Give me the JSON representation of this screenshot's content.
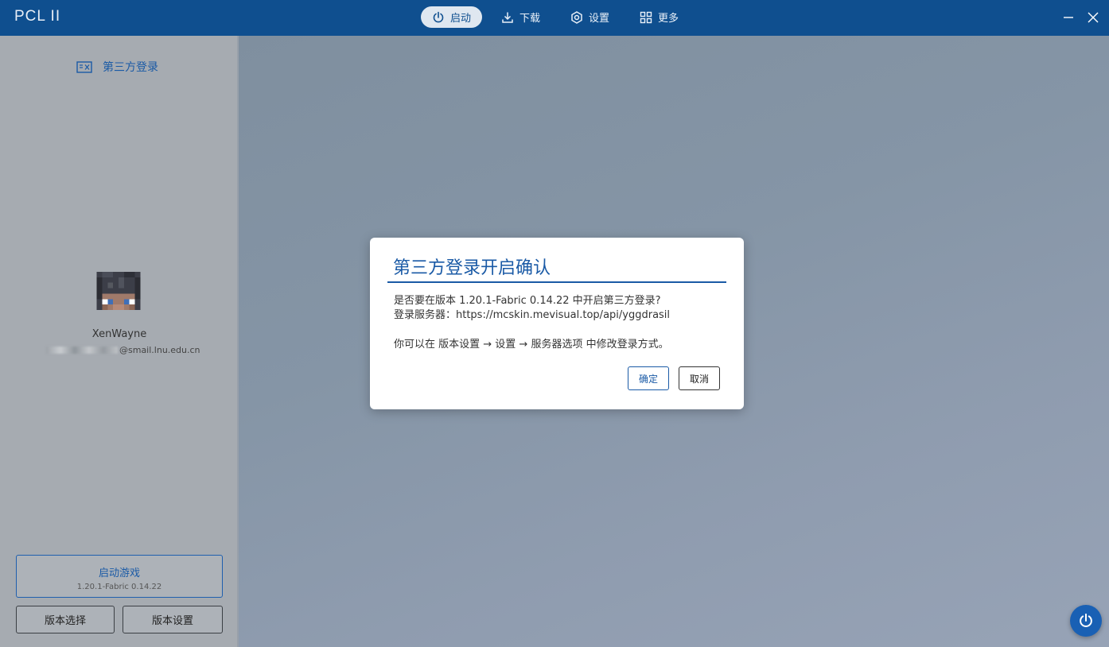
{
  "app": {
    "logo": "PCL II"
  },
  "nav": {
    "items": [
      {
        "label": "启动",
        "icon": "power-icon",
        "active": true
      },
      {
        "label": "下载",
        "icon": "download-icon",
        "active": false
      },
      {
        "label": "设置",
        "icon": "gear-icon",
        "active": false
      },
      {
        "label": "更多",
        "icon": "grid-icon",
        "active": false
      }
    ]
  },
  "sidebar": {
    "login_type_label": "第三方登录",
    "username": "XenWayne",
    "email_suffix": "@smail.lnu.edu.cn",
    "launch_button": {
      "title": "启动游戏",
      "version": "1.20.1-Fabric 0.14.22"
    },
    "version_select_label": "版本选择",
    "version_settings_label": "版本设置"
  },
  "dialog": {
    "title": "第三方登录开启确认",
    "line1": "是否要在版本 1.20.1-Fabric 0.14.22 中开启第三方登录?",
    "line2": "登录服务器：https://mcskin.mevisual.top/api/yggdrasil",
    "line3": "你可以在 版本设置 → 设置 → 服务器选项 中修改登录方式。",
    "confirm_label": "确定",
    "cancel_label": "取消"
  },
  "colors": {
    "titlebar": "#0f4f8f",
    "accent": "#1a5aa6",
    "fab": "#1960b4"
  }
}
